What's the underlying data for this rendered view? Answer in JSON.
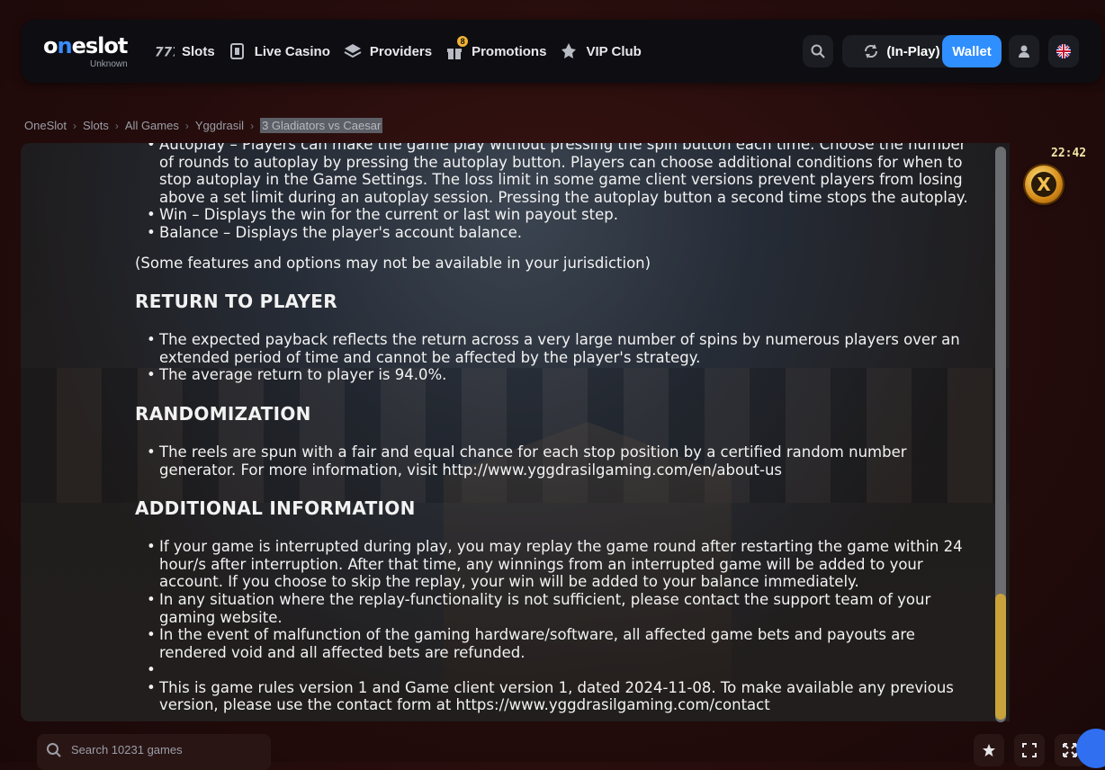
{
  "header": {
    "logo_text": "oneslot",
    "logo_sub": "Unknown",
    "nav": [
      {
        "label": "Slots",
        "icon": "slots-777-icon"
      },
      {
        "label": "Live Casino",
        "icon": "card-icon"
      },
      {
        "label": "Providers",
        "icon": "layers-icon"
      },
      {
        "label": "Promotions",
        "icon": "gift-icon",
        "badge": "8"
      },
      {
        "label": "VIP Club",
        "icon": "crown-icon"
      }
    ],
    "inplay_label": "(In-Play)",
    "wallet_label": "Wallet"
  },
  "breadcrumb": [
    "OneSlot",
    "Slots",
    "All Games",
    "Yggdrasil",
    "3 Gladiators vs Caesar"
  ],
  "game": {
    "timer": "22:42",
    "close_label": "X",
    "rules": {
      "top_items": [
        "Autoplay – Players can make the game play without pressing the spin button each time. Choose the number of rounds to autoplay by pressing the autoplay button. Players can choose additional conditions for when to stop autoplay in the Game Settings. The loss limit in some game client versions prevent players from losing above a set limit during an autoplay session. Pressing the autoplay button a second time stops the autoplay.",
        "Win – Displays the win for the current or last win payout step.",
        "Balance – Displays the player's account balance."
      ],
      "jurisdiction_note": "(Some features and options may not be available in your jurisdiction)",
      "rtp_heading": "RETURN TO PLAYER",
      "rtp_items": [
        "The expected payback reflects the return across a very large number of spins by numerous players over an extended period of time and cannot be affected by the player's strategy.",
        "The average return to player is 94.0%."
      ],
      "random_heading": "RANDOMIZATION",
      "random_items": [
        "The reels are spun with a fair and equal chance for each stop position by a certified random number generator. For more information, visit http://www.yggdrasilgaming.com/en/about-us"
      ],
      "additional_heading": "ADDITIONAL INFORMATION",
      "additional_items": [
        "If your game is interrupted during play, you may replay the game round after restarting the game within 24 hour/s after interruption. After that time, any winnings from an interrupted game will be added to your account. If you choose to skip the replay, your win will be added to your balance immediately.",
        "In any situation where the replay-functionality is not sufficient, please contact the support team of your gaming website.",
        "In the event of malfunction of the gaming hardware/software, all affected game bets and payouts are rendered void and all affected bets are refunded.",
        "",
        "This is game rules version 1 and Game client version 1, dated 2024-11-08. To make available any previous version, please use the contact form at https://www.yggdrasilgaming.com/contact"
      ]
    }
  },
  "bottom": {
    "search_placeholder": "Search 10231 games"
  },
  "colors": {
    "accent": "#2f8fff",
    "scroll_thumb": "#c9a23c",
    "badge": "#f2b233"
  }
}
